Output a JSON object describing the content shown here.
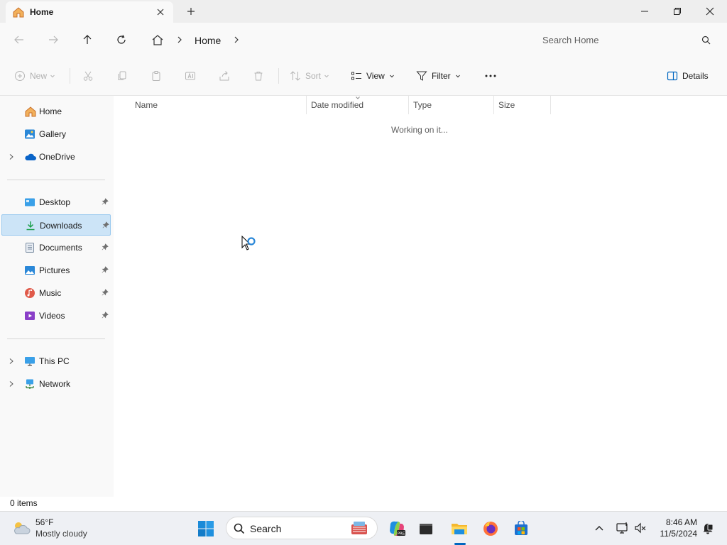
{
  "window": {
    "tab_title": "Home",
    "minimize_glyph": "—",
    "restore_glyph": "▢",
    "close_glyph": "✕"
  },
  "nav": {
    "address_segment": "Home",
    "search_placeholder": "Search Home"
  },
  "commands": {
    "new_label": "New",
    "sort_label": "Sort",
    "view_label": "View",
    "filter_label": "Filter",
    "details_label": "Details"
  },
  "sidebar": {
    "items": [
      {
        "label": "Home",
        "icon": "home-icon"
      },
      {
        "label": "Gallery",
        "icon": "gallery-icon"
      },
      {
        "label": "OneDrive",
        "icon": "onedrive-icon"
      },
      {
        "label": "Desktop",
        "icon": "desktop-icon"
      },
      {
        "label": "Downloads",
        "icon": "downloads-icon",
        "selected": true
      },
      {
        "label": "Documents",
        "icon": "documents-icon"
      },
      {
        "label": "Pictures",
        "icon": "pictures-icon"
      },
      {
        "label": "Music",
        "icon": "music-icon"
      },
      {
        "label": "Videos",
        "icon": "videos-icon"
      },
      {
        "label": "This PC",
        "icon": "this-pc-icon"
      },
      {
        "label": "Network",
        "icon": "network-icon"
      }
    ]
  },
  "content": {
    "columns": [
      "Name",
      "Date modified",
      "Type",
      "Size"
    ],
    "loading_text": "Working on it..."
  },
  "status": {
    "item_count": "0 items"
  },
  "taskbar": {
    "weather_temp": "56°F",
    "weather_desc": "Mostly cloudy",
    "search_label": "Search",
    "time": "8:46 AM",
    "date": "11/5/2024"
  },
  "colors": {
    "accent": "#0067c0",
    "selection_bg": "#cce4f7",
    "selection_border": "#99c9ef",
    "home_orange": "#e8863a"
  }
}
